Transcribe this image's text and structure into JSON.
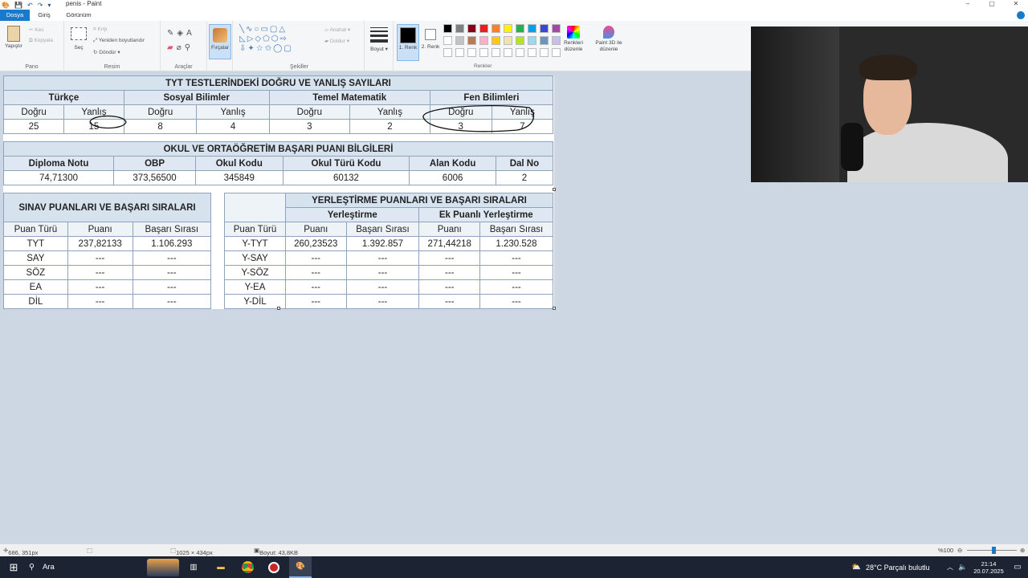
{
  "window": {
    "title": "penis - Paint",
    "controls": [
      "–",
      "▢",
      "✕"
    ]
  },
  "menu": {
    "file": "Dosya",
    "home": "Giriş",
    "view": "Görünüm"
  },
  "ribbon": {
    "clipboard": {
      "paste": "Yapıştır",
      "cut": "Kes",
      "copy": "Kopyala",
      "label": "Pano"
    },
    "image": {
      "select": "Seç",
      "crop": "Kırp",
      "resize": "Yeniden boyutlandır",
      "rotate": "Döndür",
      "label": "Resim"
    },
    "tools": {
      "label": "Araçlar",
      "brushes": "Fırçalar"
    },
    "shapes": {
      "outline": "Anahat",
      "fill": "Doldur",
      "label": "Şekiller"
    },
    "size": "Boyut",
    "color1": "1. Renk",
    "color2": "2. Renk",
    "colors_label": "Renkler",
    "edit_colors": "Renkleri düzenle",
    "paint3d": "Paint 3D ile düzenle",
    "palette_row1": [
      "#000000",
      "#7f7f7f",
      "#880015",
      "#ed1c24",
      "#ff7f27",
      "#fff200",
      "#22b14c",
      "#00a2e8",
      "#3f48cc",
      "#a349a4"
    ],
    "palette_row2": [
      "#ffffff",
      "#c3c3c3",
      "#b97a57",
      "#ffaec9",
      "#ffc90e",
      "#efe4b0",
      "#b5e61d",
      "#99d9ea",
      "#7092be",
      "#c8bfe7"
    ]
  },
  "table1": {
    "title": "TYT TESTLERİNDEKİ DOĞRU VE YANLIŞ SAYILARI",
    "subjects": [
      "Türkçe",
      "Sosyal Bilimler",
      "Temel Matematik",
      "Fen Bilimleri"
    ],
    "col_headers": [
      "Doğru",
      "Yanlış",
      "Doğru",
      "Yanlış",
      "Doğru",
      "Yanlış",
      "Doğru",
      "Yanlış"
    ],
    "values": [
      "25",
      "15",
      "8",
      "4",
      "3",
      "2",
      "3",
      "7"
    ]
  },
  "table2": {
    "title": "OKUL VE ORTAÖĞRETİM BAŞARI PUANI BİLGİLERİ",
    "headers": [
      "Diploma Notu",
      "OBP",
      "Okul Kodu",
      "Okul Türü Kodu",
      "Alan Kodu",
      "Dal No"
    ],
    "values": [
      "74,71300",
      "373,56500",
      "345849",
      "60132",
      "6006",
      "2"
    ]
  },
  "table3": {
    "title": "SINAV PUANLARI VE BAŞARI SIRALARI",
    "headers": [
      "Puan Türü",
      "Puanı",
      "Başarı Sırası"
    ],
    "rows": [
      [
        "TYT",
        "237,82133",
        "1.106.293"
      ],
      [
        "SAY",
        "---",
        "---"
      ],
      [
        "SÖZ",
        "---",
        "---"
      ],
      [
        "EA",
        "---",
        "---"
      ],
      [
        "DİL",
        "---",
        "---"
      ]
    ]
  },
  "table4": {
    "title": "YERLEŞTİRME PUANLARI VE BAŞARI SIRALARI",
    "group1": "Yerleştirme",
    "group2": "Ek Puanlı Yerleştirme",
    "headers": [
      "Puan Türü",
      "Puanı",
      "Başarı Sırası",
      "Puanı",
      "Başarı Sırası"
    ],
    "rows": [
      [
        "Y-TYT",
        "260,23523",
        "1.392.857",
        "271,44218",
        "1.230.528"
      ],
      [
        "Y-SAY",
        "---",
        "---",
        "---",
        "---"
      ],
      [
        "Y-SÖZ",
        "---",
        "---",
        "---",
        "---"
      ],
      [
        "Y-EA",
        "---",
        "---",
        "---",
        "---"
      ],
      [
        "Y-DİL",
        "---",
        "---",
        "---",
        "---"
      ]
    ]
  },
  "status": {
    "cursor": "686, 351px",
    "canvas_size": "1025 × 434px",
    "file_size": "Boyut: 43,8KB",
    "zoom": "%100"
  },
  "taskbar": {
    "search": "Ara",
    "weather": "28°C  Parçalı bulutlu",
    "time": "21:14",
    "date": "20.07.2025"
  }
}
